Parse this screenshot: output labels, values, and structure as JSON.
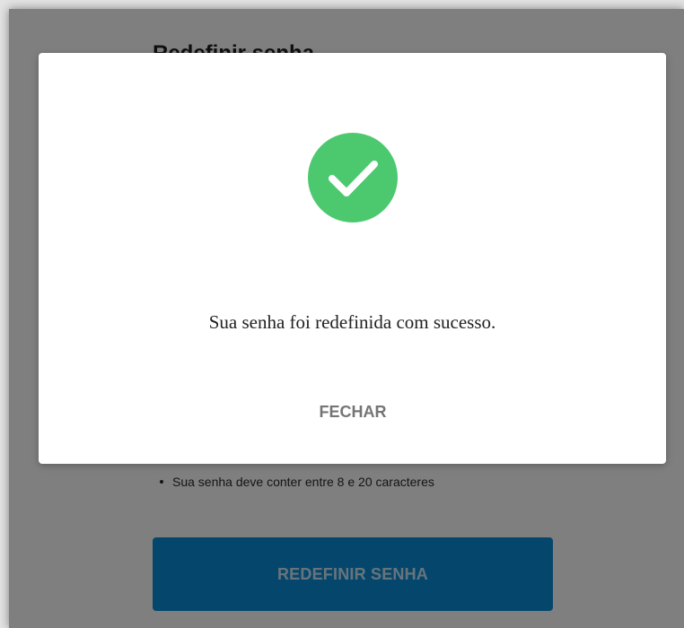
{
  "page": {
    "title": "Redefinir senha",
    "rules": [
      "Sua senha deve conter entre 8 e 20 caracteres"
    ],
    "reset_button_label": "REDEFINIR SENHA"
  },
  "dialog": {
    "icon": "check-circle-icon",
    "message": "Sua senha foi redefinida com sucesso.",
    "close_label": "FECHAR"
  },
  "colors": {
    "success": "#4CC96F",
    "primary_button": "#0A8FD8",
    "overlay": "rgba(0,0,0,0.5)"
  }
}
